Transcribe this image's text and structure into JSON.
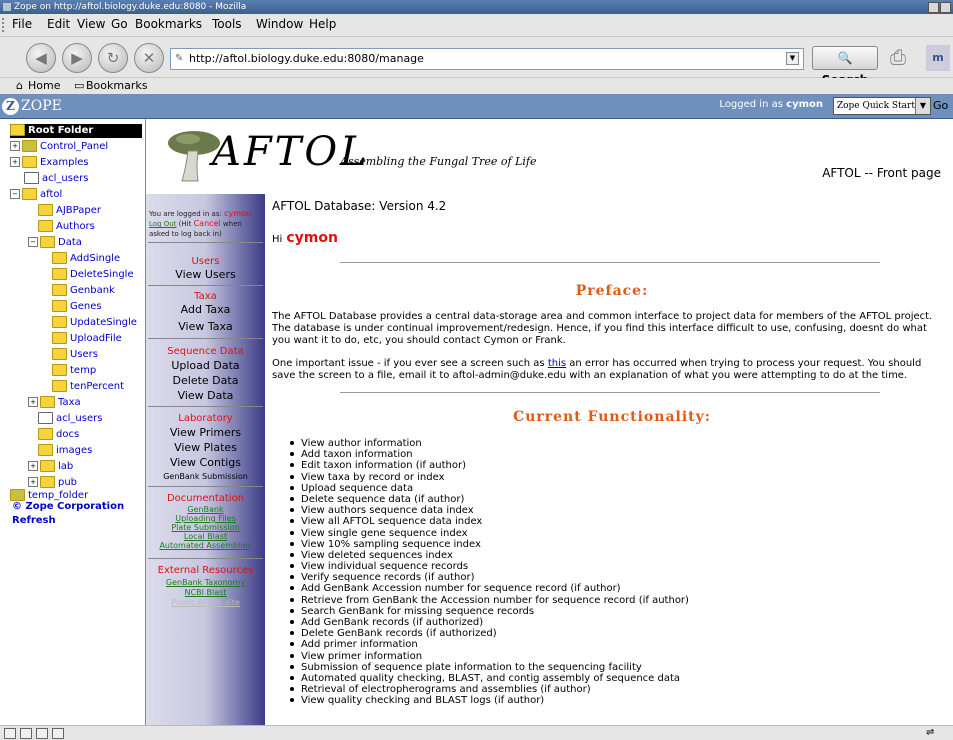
{
  "window": {
    "title": "Zope on http://aftol.biology.duke.edu:8080 - Mozilla"
  },
  "menu": [
    "File",
    "Edit",
    "View",
    "Go",
    "Bookmarks",
    "Tools",
    "Window",
    "Help"
  ],
  "nav": {
    "url": "http://aftol.biology.duke.edu:8080/manage",
    "search_label": "Search"
  },
  "bookmarks": {
    "home": "Home",
    "bookmarks": "Bookmarks"
  },
  "zope": {
    "logo": "ZOPE",
    "logged_prefix": "Logged in as",
    "user": "cymon",
    "quick_start": "Zope Quick Start",
    "go": "Go"
  },
  "tree": {
    "root": "Root Folder",
    "items": [
      {
        "label": "Control_Panel"
      },
      {
        "label": "Examples"
      },
      {
        "label": "acl_users"
      },
      {
        "label": "aftol"
      },
      {
        "label": "AJBPaper"
      },
      {
        "label": "Authors"
      },
      {
        "label": "Data"
      },
      {
        "label": "AddSingle"
      },
      {
        "label": "DeleteSingle"
      },
      {
        "label": "Genbank"
      },
      {
        "label": "Genes"
      },
      {
        "label": "UpdateSingle"
      },
      {
        "label": "UploadFile"
      },
      {
        "label": "Users"
      },
      {
        "label": "temp"
      },
      {
        "label": "tenPercent"
      },
      {
        "label": "Taxa"
      },
      {
        "label": "acl_users"
      },
      {
        "label": "docs"
      },
      {
        "label": "images"
      },
      {
        "label": "lab"
      },
      {
        "label": "pub"
      },
      {
        "label": "temp_folder"
      }
    ],
    "copyright": "© Zope Corporation",
    "refresh": "Refresh"
  },
  "header": {
    "title": "AFTOL",
    "subtitle": "Assembling the Fungal Tree of Life",
    "page": "AFTOL -- Front page"
  },
  "sidebar": {
    "login_line1": "You are logged in as:",
    "login_user": "cymon",
    "logout": "Log Out",
    "login_hit": "(Hit",
    "cancel": "Cancel",
    "login_when": "when asked to log back in)",
    "users_head": "Users",
    "view_users": "View Users",
    "taxa_head": "Taxa",
    "add_taxa": "Add Taxa",
    "view_taxa": "View Taxa",
    "seq_head": "Sequence Data",
    "upload_data": "Upload Data",
    "delete_data": "Delete Data",
    "view_data": "View Data",
    "lab_head": "Laboratory",
    "view_primers": "View Primers",
    "view_plates": "View Plates",
    "view_contigs": "View Contigs",
    "genbank_sub": "GenBank Submission",
    "doc_head": "Documentation",
    "doc_links": [
      "GenBank",
      "Uploading Files",
      "Plate Submission",
      "Local Blast",
      "Automated Assemblies"
    ],
    "ext_head": "External Resources",
    "ext_links": [
      "GenBank Taxonomy",
      "NCBI Blast",
      "Public AFTOL site"
    ]
  },
  "main": {
    "version": "AFTOL Database: Version 4.2",
    "hi": "Hi",
    "user": "cymon",
    "preface_title": "Preface:",
    "preface_p1": "The AFTOL Database provides a central data-storage area and common interface to project data for members of the AFTOL project. The database is under continual improvement/redesign. Hence, if you find this interface difficult to use, confusing, doesnt do what you want it to do, etc, you should contact Cymon or Frank.",
    "preface_p2_a": "One important issue - if you ever see a screen such as",
    "preface_p2_link": "this",
    "preface_p2_b": "an error has occurred when trying to process your request. You should save the screen to a file, email it to aftol-admin@duke.edu with an explanation of what you were attempting to do at the time.",
    "func_title": "Current Functionality:",
    "functions": [
      "View author information",
      "Add taxon information",
      "Edit taxon information (if author)",
      "View taxa by record or index",
      "Upload sequence data",
      "Delete sequence data (if author)",
      "View authors sequence data index",
      "View all AFTOL sequence data index",
      "View single gene sequence index",
      "View 10% sampling sequence index",
      "View deleted sequences index",
      "View individual sequence records",
      "Verify sequence records (if author)",
      "Add GenBank Accession number for sequence record (if author)",
      "Retrieve from GenBank the Accession number for sequence record (if author)",
      "Search GenBank for missing sequence records",
      "Add GenBank records (if authorized)",
      "Delete GenBank records (if authorized)",
      "Add primer information",
      "View primer information",
      "Submission of sequence plate information to the sequencing facility",
      "Automated quality checking, BLAST, and contig assembly of sequence data",
      "Retrieval of electropherograms and assemblies (if author)",
      "View quality checking and BLAST logs (if author)"
    ]
  }
}
